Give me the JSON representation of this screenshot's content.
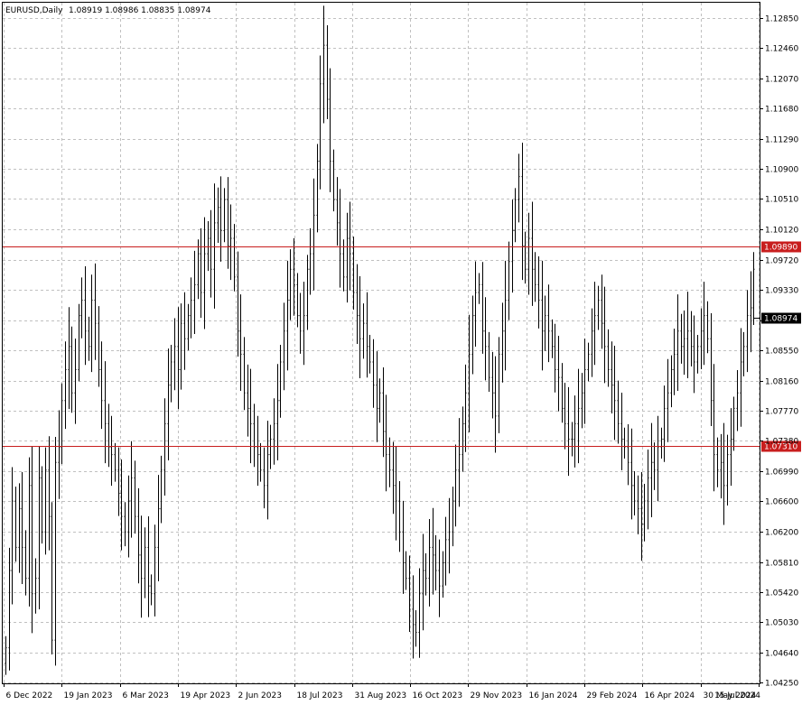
{
  "header": {
    "symbol": "EURUSD,Daily",
    "ohlc": "1.08919 1.08986 1.08835 1.08974"
  },
  "colors": {
    "background": "#ffffff",
    "grid": "#c0c0c0",
    "bars": "#000000",
    "level_line": "#c81e1e",
    "level_label_bg": "#c81e1e",
    "level_label_text": "#ffffff",
    "price_label_bg": "#000000",
    "price_label_text": "#ffffff"
  },
  "chart_data": {
    "type": "ohlc-bar",
    "title": "EURUSD,Daily",
    "xlabel": "",
    "ylabel": "",
    "ylim": [
      1.0424,
      1.1305
    ],
    "grid": true,
    "y_ticks": [
      "1.12850",
      "1.12460",
      "1.12070",
      "1.11680",
      "1.11290",
      "1.10900",
      "1.10510",
      "1.10120",
      "1.09720",
      "1.09330",
      "1.08940",
      "1.08550",
      "1.08160",
      "1.07770",
      "1.07380",
      "1.06990",
      "1.06600",
      "1.06200",
      "1.05810",
      "1.05420",
      "1.05030",
      "1.04640",
      "1.04250"
    ],
    "x_ticks": [
      "6 Dec 2022",
      "19 Jan 2023",
      "6 Mar 2023",
      "19 Apr 2023",
      "2 Jun 2023",
      "18 Jul 2023",
      "31 Aug 2023",
      "16 Oct 2023",
      "29 Nov 2023",
      "16 Jan 2024",
      "29 Feb 2024",
      "16 Apr 2024",
      "30 May 2024",
      "15 Jul 2024"
    ],
    "levels": [
      {
        "value": 1.0989,
        "label": "1.09890"
      },
      {
        "value": 1.0731,
        "label": "1.07310"
      }
    ],
    "current_price": {
      "value": 1.08974,
      "label": "1.08974"
    },
    "closes": [
      1.047,
      1.057,
      1.066,
      1.06,
      1.065,
      1.06,
      1.056,
      1.068,
      1.054,
      1.056,
      1.069,
      1.062,
      1.07,
      1.064,
      1.048,
      1.071,
      1.073,
      1.079,
      1.083,
      1.086,
      1.08,
      1.083,
      1.09,
      1.092,
      1.088,
      1.086,
      1.092,
      1.089,
      1.083,
      1.079,
      1.076,
      1.073,
      1.072,
      1.07,
      1.067,
      1.064,
      1.062,
      1.066,
      1.069,
      1.064,
      1.059,
      1.056,
      1.06,
      1.055,
      1.054,
      1.06,
      1.065,
      1.07,
      1.076,
      1.081,
      1.084,
      1.086,
      1.083,
      1.089,
      1.087,
      1.09,
      1.092,
      1.094,
      1.098,
      1.093,
      1.098,
      1.1,
      1.096,
      1.102,
      1.104,
      1.101,
      1.105,
      1.099,
      1.1,
      1.095,
      1.088,
      1.085,
      1.08,
      1.078,
      1.076,
      1.073,
      1.072,
      1.07,
      1.068,
      1.072,
      1.074,
      1.076,
      1.079,
      1.084,
      1.088,
      1.092,
      1.096,
      1.094,
      1.09,
      1.088,
      1.09,
      1.096,
      1.098,
      1.103,
      1.11,
      1.12,
      1.125,
      1.118,
      1.11,
      1.105,
      1.102,
      1.098,
      1.095,
      1.1,
      1.098,
      1.093,
      1.09,
      1.087,
      1.089,
      1.086,
      1.084,
      1.081,
      1.078,
      1.08,
      1.075,
      1.072,
      1.07,
      1.068,
      1.066,
      1.062,
      1.058,
      1.056,
      1.052,
      1.05,
      1.049,
      1.054,
      1.057,
      1.056,
      1.06,
      1.059,
      1.057,
      1.055,
      1.058,
      1.061,
      1.062,
      1.066,
      1.07,
      1.072,
      1.076,
      1.08,
      1.085,
      1.09,
      1.093,
      1.094,
      1.088,
      1.086,
      1.082,
      1.08,
      1.077,
      1.085,
      1.088,
      1.092,
      1.097,
      1.101,
      1.105,
      1.108,
      1.099,
      1.096,
      1.1,
      1.096,
      1.094,
      1.092,
      1.088,
      1.09,
      1.088,
      1.086,
      1.083,
      1.082,
      1.078,
      1.076,
      1.074,
      1.074,
      1.076,
      1.078,
      1.08,
      1.083,
      1.085,
      1.088,
      1.09,
      1.092,
      1.089,
      1.086,
      1.083,
      1.081,
      1.079,
      1.076,
      1.074,
      1.073,
      1.071,
      1.068,
      1.066,
      1.065,
      1.063,
      1.066,
      1.069,
      1.071,
      1.07,
      1.073,
      1.074,
      1.078,
      1.08,
      1.083,
      1.085,
      1.088,
      1.086,
      1.087,
      1.088,
      1.086,
      1.084,
      1.086,
      1.088,
      1.09,
      1.087,
      1.079,
      1.072,
      1.07,
      1.071,
      1.068,
      1.072,
      1.074,
      1.078,
      1.08,
      1.084,
      1.086,
      1.09,
      1.091,
      1.096
    ]
  }
}
